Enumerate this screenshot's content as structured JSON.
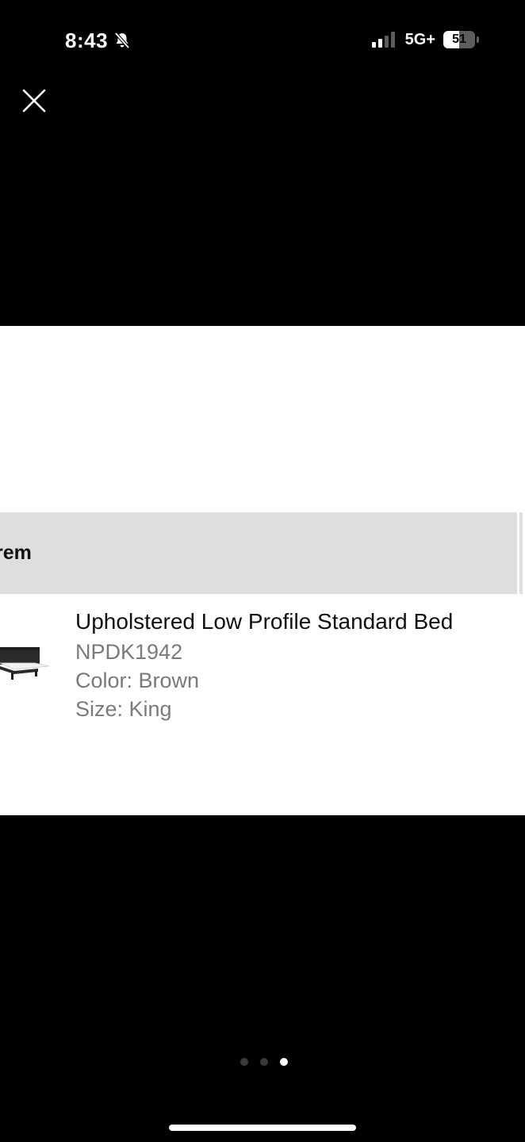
{
  "status_bar": {
    "time": "8:43",
    "network": "5G+",
    "battery_level": "51",
    "battery_fraction": 0.51,
    "signal_bars_active": 2,
    "signal_bars_total": 4,
    "icons": {
      "silent": "bell-slash-icon",
      "signal": "cellular-signal-icon",
      "battery": "battery-icon"
    }
  },
  "viewer": {
    "close_icon": "close-icon",
    "page_count": 3,
    "current_page": 3
  },
  "image": {
    "header_label": "rem",
    "product": {
      "name": "Upholstered Low Profile Standard Bed",
      "sku": "NPDK1942",
      "color": "Color: Brown",
      "size": "Size: King"
    }
  },
  "colors": {
    "background": "#000000",
    "panel": "#ffffff",
    "header_band": "#dedede",
    "primary_text": "#111111",
    "secondary_text": "#7a7a7a",
    "dot_active": "#ffffff",
    "dot_inactive": "#3a3a3a"
  }
}
